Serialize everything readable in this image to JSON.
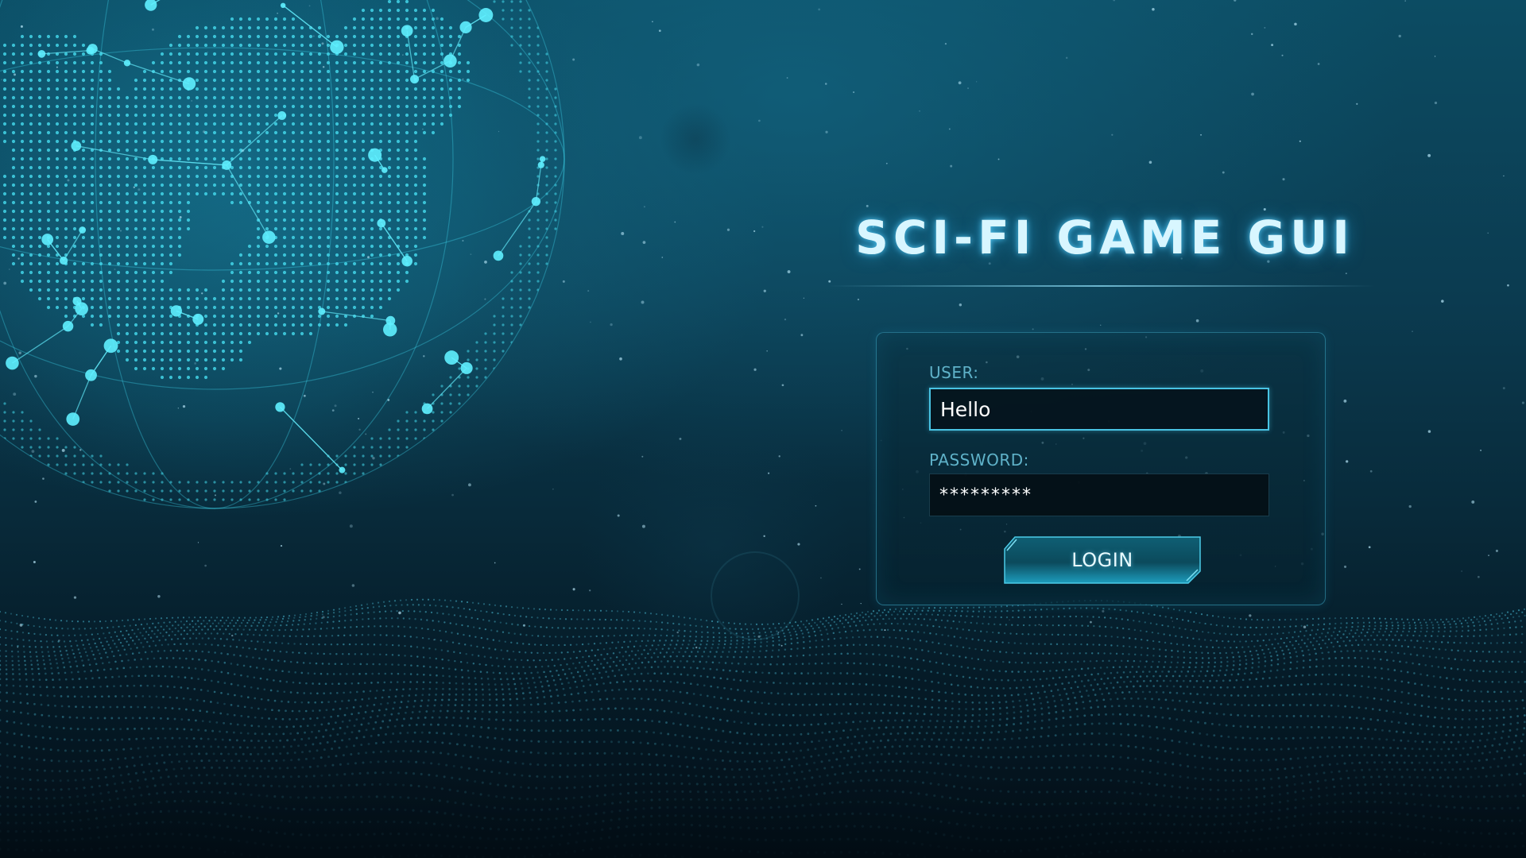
{
  "app": {
    "title": "SCI-FI GAME GUI"
  },
  "login": {
    "user_label": "USER:",
    "user_value": "Hello",
    "password_label": "PASSWORD:",
    "password_value": "*********",
    "login_label": "LOGIN"
  },
  "colors": {
    "accent": "#48c3e3",
    "title_glow": "#5ad2ff",
    "label": "#5fb2c9",
    "background_top": "#0c4c63",
    "background_bottom": "#03121c"
  },
  "decor": {
    "globe": "wireframe-globe-constellation",
    "floor": "particle-wave-field"
  }
}
